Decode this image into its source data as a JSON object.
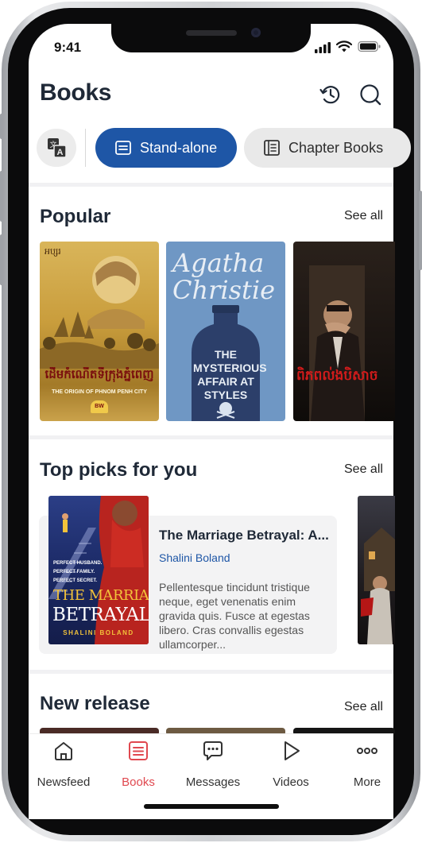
{
  "status_bar": {
    "time": "9:41"
  },
  "header": {
    "title": "Books"
  },
  "tabs": [
    {
      "label": "Stand-alone",
      "active": true
    },
    {
      "label": "Chapter Books",
      "active": false
    }
  ],
  "popular": {
    "title": "Popular",
    "see_all": "See all",
    "books": [
      {
        "cover_title": "ដើមកំណើតទីក្រុងភ្នំពេញ",
        "cover_subtitle": "THE ORIGIN OF PHNOM PENH CITY",
        "publisher_mark": "BW",
        "brand_mark": "អប្សរ"
      },
      {
        "cover_author": "Agatha Christie",
        "cover_title": "THE MYSTERIOUS AFFAIR AT STYLES"
      },
      {
        "cover_title": "ពិភពល់ងបិសាច"
      }
    ]
  },
  "top_picks": {
    "title": "Top picks for you",
    "see_all": "See all",
    "item": {
      "title": "The Marriage Betrayal: A...",
      "author": "Shalini Boland",
      "description": "Pellentesque tincidunt tristique neque, eget venenatis enim gravida quis. Fusce at egestas libero. Cras convallis egestas ullamcorper...",
      "cover_tagline": [
        "PERFECT HUSBAND.",
        "PERFECT FAMILY.",
        "PERFECT SECRET."
      ],
      "cover_title_1": "THE MARRIAGE",
      "cover_title_2": "BETRAYAL",
      "cover_author": "SHALINI BOLAND"
    }
  },
  "new_release": {
    "title": "New release",
    "see_all": "See all"
  },
  "bottom_nav": [
    {
      "label": "Newsfeed",
      "icon": "home-icon",
      "active": false
    },
    {
      "label": "Books",
      "icon": "book-icon",
      "active": true
    },
    {
      "label": "Messages",
      "icon": "chat-icon",
      "active": false
    },
    {
      "label": "Videos",
      "icon": "play-icon",
      "active": false
    },
    {
      "label": "More",
      "icon": "more-icon",
      "active": false
    }
  ],
  "colors": {
    "accent": "#1e56a6",
    "active_nav": "#e0484f"
  }
}
